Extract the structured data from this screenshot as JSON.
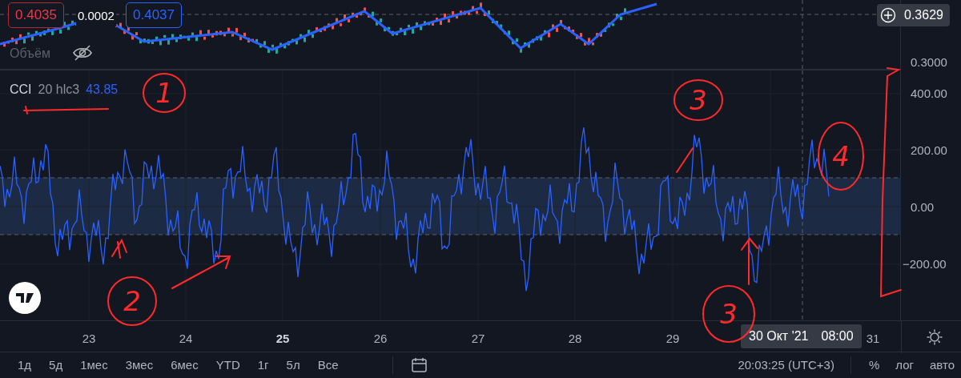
{
  "price_pane": {
    "bid": "0.4035",
    "spread": "0.0002",
    "ask": "0.4037",
    "volume_label": "Объём",
    "crosshair_price": "0.3629",
    "axis_labels": [
      "0.3000"
    ]
  },
  "indicator": {
    "name": "CCI",
    "params": "20 hlc3",
    "value": "43.85",
    "axis_labels": [
      "400.00",
      "200.00",
      "0.00",
      "−200.00"
    ]
  },
  "time_axis": {
    "labels": [
      {
        "text": "23",
        "bold": false
      },
      {
        "text": "24",
        "bold": false
      },
      {
        "text": "25",
        "bold": true
      },
      {
        "text": "26",
        "bold": false
      },
      {
        "text": "27",
        "bold": false
      },
      {
        "text": "28",
        "bold": false
      },
      {
        "text": "29",
        "bold": false
      },
      {
        "text": "31",
        "bold": false
      }
    ],
    "crosshair_date": "30 Окт '21",
    "crosshair_time": "08:00"
  },
  "toolbar": {
    "ranges": [
      "1д",
      "5д",
      "1мес",
      "3мес",
      "6мес",
      "YTD",
      "1г",
      "5л",
      "Все"
    ],
    "clock": "20:03:25 (UTC+3)",
    "options": [
      "%",
      "лог",
      "авто"
    ]
  },
  "annotations": [
    {
      "label": "1"
    },
    {
      "label": "3"
    },
    {
      "label": "4"
    },
    {
      "label": "2"
    },
    {
      "label": "3"
    }
  ]
}
